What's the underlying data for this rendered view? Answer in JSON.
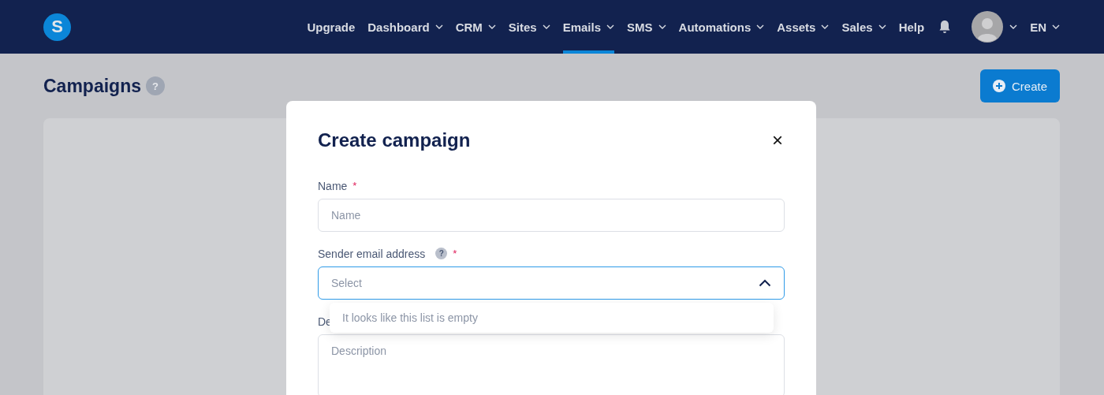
{
  "nav": {
    "items": [
      {
        "label": "Upgrade",
        "dropdown": false,
        "selected": false
      },
      {
        "label": "Dashboard",
        "dropdown": true,
        "selected": false
      },
      {
        "label": "CRM",
        "dropdown": true,
        "selected": false
      },
      {
        "label": "Sites",
        "dropdown": true,
        "selected": false
      },
      {
        "label": "Emails",
        "dropdown": true,
        "selected": true
      },
      {
        "label": "SMS",
        "dropdown": true,
        "selected": false
      },
      {
        "label": "Automations",
        "dropdown": true,
        "selected": false
      },
      {
        "label": "Assets",
        "dropdown": true,
        "selected": false
      },
      {
        "label": "Sales",
        "dropdown": true,
        "selected": false
      },
      {
        "label": "Help",
        "dropdown": false,
        "selected": false
      }
    ],
    "logo": "S",
    "language": "EN"
  },
  "page": {
    "title": "Campaigns",
    "help": "?",
    "create_button": "Create"
  },
  "modal": {
    "title": "Create campaign",
    "close": "×",
    "fields": [
      {
        "kind": "input",
        "label": "Name",
        "required": "*",
        "placeholder": "Name"
      },
      {
        "kind": "select",
        "label": "Sender email address",
        "help": "?",
        "required": "*",
        "placeholder": "Select",
        "expanded": true,
        "empty_message": "It looks like this list is empty"
      },
      {
        "kind": "textarea",
        "label": "De",
        "placeholder": "Description"
      }
    ]
  }
}
